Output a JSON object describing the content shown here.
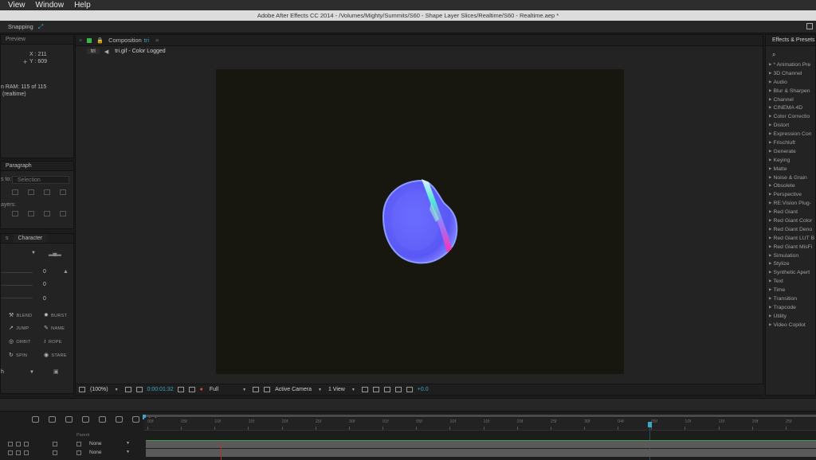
{
  "menu": [
    "View",
    "Window",
    "Help"
  ],
  "title": "Adobe After Effects CC 2014 - /Volumes/Mighty/Summits/S60 - Shape Layer Slices/Realtime/S60 - Realtime.aep *",
  "toolbar": {
    "snapping": "Snapping"
  },
  "info": {
    "tab": "Preview",
    "x": "X : 211",
    "y": "Y : 609",
    "ram_line1": "n RAM: 115 of 115",
    "ram_line2": "(realtime)"
  },
  "paragraph": {
    "tab": "Paragraph",
    "align_to": "s to:",
    "selection": "Selection",
    "layers": "ayers:"
  },
  "character": {
    "tab_left": "s",
    "tab": "Character",
    "values": [
      "0",
      "0",
      "0"
    ],
    "buttons": [
      "BLEND",
      "BURST",
      "JUMP",
      "NAME",
      "ORBIT",
      "ROPE",
      "SPIN",
      "STARE"
    ],
    "bottom": "h"
  },
  "composition": {
    "tab": "Composition",
    "tab_sub": "tri",
    "layer_chip": "tri",
    "layer_name": "tri.gif - Color Logged",
    "background": "#18170f",
    "footer": {
      "zoom": "(100%)",
      "timecode": "0:00:01:32",
      "resolution": "Full",
      "camera": "Active Camera",
      "view": "1 View",
      "exposure": "+0.0"
    }
  },
  "effects": {
    "tab": "Effects & Presets",
    "search": "search-icon",
    "items": [
      "* Animation Pre",
      "3D Channel",
      "Audio",
      "Blur & Sharpen",
      "Channel",
      "CINEMA 4D",
      "Color Correctio",
      "Distort",
      "Expression Con",
      "Frischluft",
      "Generate",
      "Keying",
      "Matte",
      "Noise & Grain",
      "Obsolete",
      "Perspective",
      "RE:Vision Plug-",
      "Red Giant",
      "Red Giant Color",
      "Red Giant Deno",
      "Red Giant LUT B",
      "Red Giant MisFi",
      "Simulation",
      "Stylize",
      "Synthetic Apert",
      "Text",
      "Time",
      "Transition",
      "Trapcode",
      "Utility",
      "Video Copilot"
    ]
  },
  "timeline": {
    "ticks": [
      "00f",
      "05f",
      "10f",
      "15f",
      "20f",
      "25f",
      "30f",
      "01f",
      "05f",
      "10f",
      "15f",
      "20f",
      "25f",
      "30f",
      "04f",
      "05f",
      "10f",
      "15f",
      "20f",
      "25f"
    ],
    "parent_header": "Parent",
    "rows": [
      {
        "parent": "None"
      },
      {
        "parent": "None"
      }
    ],
    "accent": "#3aa7c9"
  }
}
